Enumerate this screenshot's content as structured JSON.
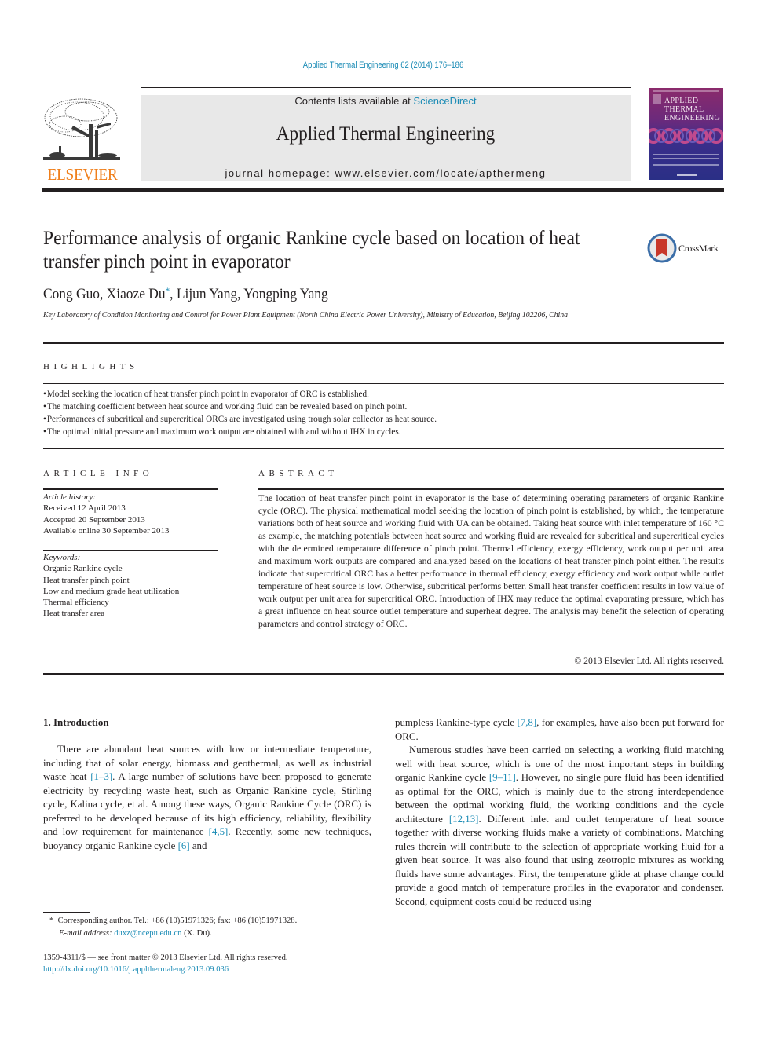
{
  "header": {
    "citation": "Applied Thermal Engineering 62 (2014) 176–186",
    "contents_prefix": "Contents lists available at ",
    "contents_link": "ScienceDirect",
    "journal_title": "Applied Thermal Engineering",
    "homepage": "journal homepage: www.elsevier.com/locate/apthermeng",
    "publisher_logo_text": "ELSEVIER",
    "cover": {
      "title_lines": [
        "Applied",
        "Thermal",
        "Engineering"
      ],
      "colors": {
        "top": "#8b2a6b",
        "bottom": "#2a2f86"
      }
    },
    "colors": {
      "link": "#1a8bb5",
      "elsevier_orange": "#f07f1b",
      "masthead_bg": "#e8e8e8"
    }
  },
  "article": {
    "title": "Performance analysis of organic Rankine cycle based on location of heat transfer pinch point in evaporator",
    "crossmark_label": "CrossMark",
    "authors": [
      {
        "name": "Cong Guo",
        "corresponding": false
      },
      {
        "name": "Xiaoze Du",
        "corresponding": true
      },
      {
        "name": "Lijun Yang",
        "corresponding": false
      },
      {
        "name": "Yongping Yang",
        "corresponding": false
      }
    ],
    "author_separator": ", ",
    "corresponding_mark": "*",
    "affiliation": "Key Laboratory of Condition Monitoring and Control for Power Plant Equipment (North China Electric Power University), Ministry of Education, Beijing 102206, China"
  },
  "highlights": {
    "label": "HIGHLIGHTS",
    "items": [
      "Model seeking the location of heat transfer pinch point in evaporator of ORC is established.",
      "The matching coefficient between heat source and working fluid can be revealed based on pinch point.",
      "Performances of subcritical and supercritical ORCs are investigated using trough solar collector as heat source.",
      "The optimal initial pressure and maximum work output are obtained with and without IHX in cycles."
    ]
  },
  "article_info": {
    "label": "ARTICLE INFO",
    "history_label": "Article history:",
    "history": [
      "Received 12 April 2013",
      "Accepted 20 September 2013",
      "Available online 30 September 2013"
    ],
    "keywords_label": "Keywords:",
    "keywords": [
      "Organic Rankine cycle",
      "Heat transfer pinch point",
      "Low and medium grade heat utilization",
      "Thermal efficiency",
      "Heat transfer area"
    ]
  },
  "abstract": {
    "label": "ABSTRACT",
    "text": "The location of heat transfer pinch point in evaporator is the base of determining operating parameters of organic Rankine cycle (ORC). The physical mathematical model seeking the location of pinch point is established, by which, the temperature variations both of heat source and working fluid with UA can be obtained. Taking heat source with inlet temperature of 160 °C as example, the matching potentials between heat source and working fluid are revealed for subcritical and supercritical cycles with the determined temperature difference of pinch point. Thermal efficiency, exergy efficiency, work output per unit area and maximum work outputs are compared and analyzed based on the locations of heat transfer pinch point either. The results indicate that supercritical ORC has a better performance in thermal efficiency, exergy efficiency and work output while outlet temperature of heat source is low. Otherwise, subcritical performs better. Small heat transfer coefficient results in low value of work output per unit area for supercritical ORC. Introduction of IHX may reduce the optimal evaporating pressure, which has a great influence on heat source outlet temperature and superheat degree. The analysis may benefit the selection of operating parameters and control strategy of ORC.",
    "copyright": "© 2013 Elsevier Ltd. All rights reserved."
  },
  "introduction": {
    "heading": "1.  Introduction",
    "left_column": {
      "p1": [
        {
          "t": "There are abundant heat sources with low or intermediate temperature, including that of solar energy, biomass and geothermal, as well as industrial waste heat "
        },
        {
          "ref": "[1–3]"
        },
        {
          "t": ". A large number of solutions have been proposed to generate electricity by recycling waste heat, such as Organic Rankine cycle, Stirling cycle, Kalina cycle, et al. Among these ways, Organic Rankine Cycle (ORC) is preferred to be developed because of its high efficiency, reliability, flexibility and low requirement for maintenance "
        },
        {
          "ref": "[4,5]"
        },
        {
          "t": ". Recently, some new techniques, buoyancy organic Rankine cycle "
        },
        {
          "ref": "[6]"
        },
        {
          "t": " and"
        }
      ]
    },
    "right_column": {
      "p1": [
        {
          "t": "pumpless Rankine-type cycle "
        },
        {
          "ref": "[7,8]"
        },
        {
          "t": ", for examples, have also been put forward for ORC."
        }
      ],
      "p2": [
        {
          "t": "Numerous studies have been carried on selecting a working fluid matching well with heat source, which is one of the most important steps in building organic Rankine cycle "
        },
        {
          "ref": "[9–11]"
        },
        {
          "t": ". However, no single pure fluid has been identified as optimal for the ORC, which is mainly due to the strong interdependence between the optimal working fluid, the working conditions and the cycle architecture "
        },
        {
          "ref": "[12,13]"
        },
        {
          "t": ". Different inlet and outlet temperature of heat source together with diverse working fluids make a variety of combinations. Matching rules therein will contribute to the selection of appropriate working fluid for a given heat source. It was also found that using zeotropic mixtures as working fluids have some advantages. First, the temperature glide at phase change could provide a good match of temperature profiles in the evaporator and condenser. Second, equipment costs could be reduced using"
        }
      ]
    }
  },
  "footnote": {
    "mark": "*",
    "corresponding": "Corresponding author. Tel.: +86 (10)51971326; fax: +86 (10)51971328.",
    "email_label": "E-mail address: ",
    "email": "duxz@ncepu.edu.cn",
    "email_suffix": " (X. Du).",
    "issn_line": "1359-4311/$ — see front matter © 2013 Elsevier Ltd. All rights reserved.",
    "doi": "http://dx.doi.org/10.1016/j.applthermaleng.2013.09.036"
  }
}
